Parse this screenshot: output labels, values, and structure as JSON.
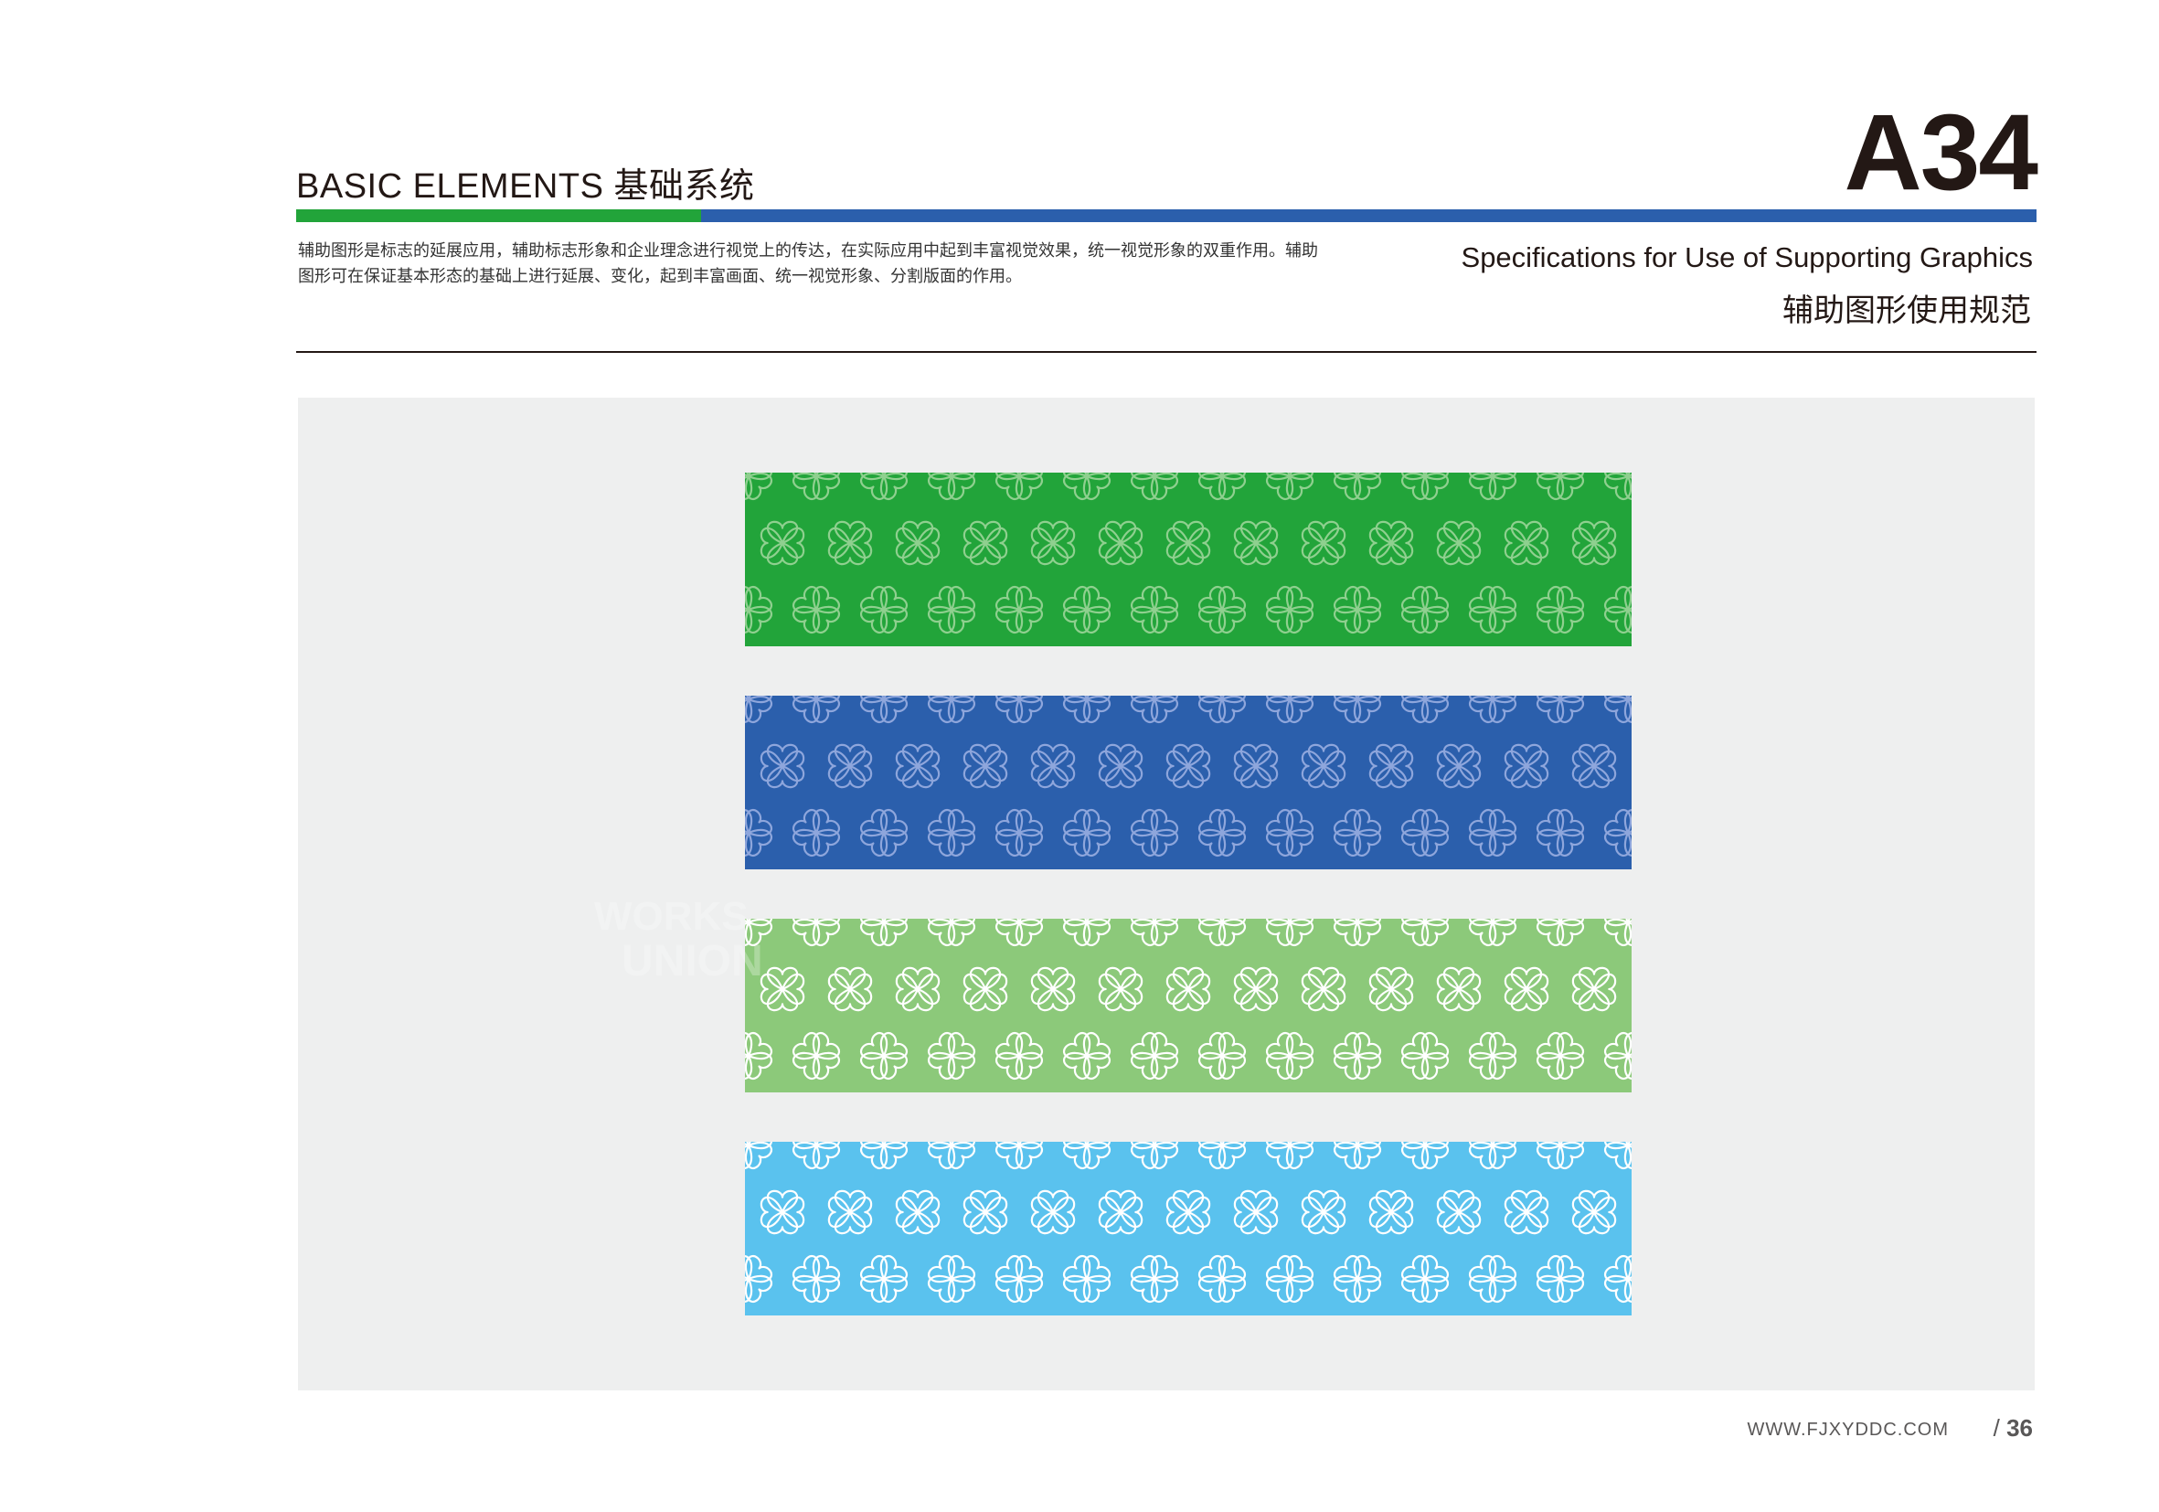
{
  "header": {
    "section_title": "BASIC ELEMENTS 基础系统",
    "page_code": "A34",
    "description": "辅助图形是标志的延展应用，辅助标志形象和企业理念进行视觉上的传达，在实际应用中起到丰富视觉效果，统一视觉形象的双重作用。辅助图形可在保证基本形态的基础上进行延展、变化，起到丰富画面、统一视觉形象、分割版面的作用。",
    "spec_title_en": "Specifications for Use of Supporting Graphics",
    "spec_title_cn": "辅助图形使用规范"
  },
  "colors": {
    "brand_green": "#22a43a",
    "brand_blue": "#2b5fac",
    "light_green": "#8cc97a",
    "sky_blue": "#5ac2ee",
    "panel_gray": "#eeefef"
  },
  "swatches": [
    {
      "name": "green",
      "bg": "#22a43a",
      "stroke": "#8fd08f"
    },
    {
      "name": "blue",
      "bg": "#2b5fac",
      "stroke": "#8ea6dc"
    },
    {
      "name": "light-green",
      "bg": "#8cc97a",
      "stroke": "#ffffff"
    },
    {
      "name": "sky-blue",
      "bg": "#5ac2ee",
      "stroke": "#ffffff"
    }
  ],
  "watermark": {
    "line1": "WORKS",
    "line2": "UNION"
  },
  "footer": {
    "url": "WWW.FJXYDDC.COM",
    "page_separator": "/",
    "page_number": "36"
  }
}
